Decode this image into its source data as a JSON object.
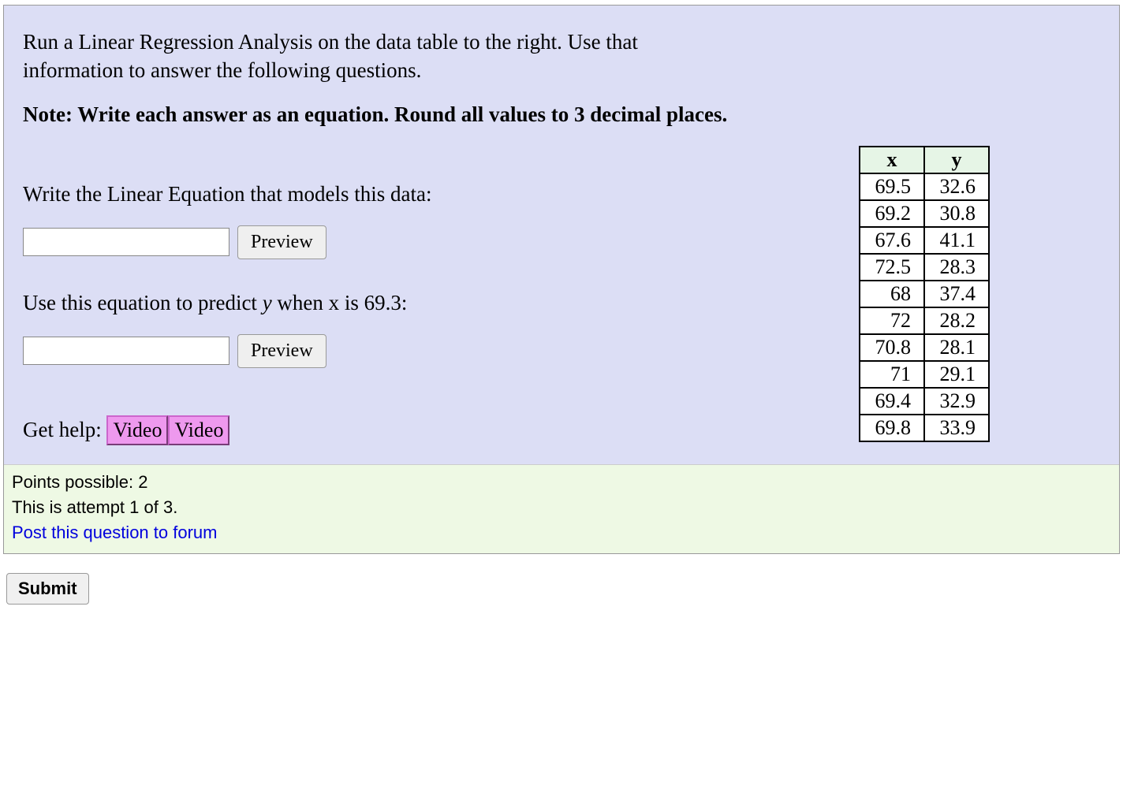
{
  "intro": "Run a Linear Regression Analysis on the data table to the right. Use that information to answer the following questions.",
  "note": "Note: Write each answer as an equation. Round all values to 3 decimal places.",
  "prompt1": "Write the Linear Equation that models this data:",
  "prompt2_prefix": "Use this equation to predict ",
  "prompt2_yvar": "y",
  "prompt2_suffix": " when x is 69.3:",
  "preview_label": "Preview",
  "table": {
    "headers": {
      "x": "x",
      "y": "y"
    },
    "rows": [
      {
        "x": "69.5",
        "y": "32.6"
      },
      {
        "x": "69.2",
        "y": "30.8"
      },
      {
        "x": "67.6",
        "y": "41.1"
      },
      {
        "x": "72.5",
        "y": "28.3"
      },
      {
        "x": "68",
        "y": "37.4"
      },
      {
        "x": "72",
        "y": "28.2"
      },
      {
        "x": "70.8",
        "y": "28.1"
      },
      {
        "x": "71",
        "y": "29.1"
      },
      {
        "x": "69.4",
        "y": "32.9"
      },
      {
        "x": "69.8",
        "y": "33.9"
      }
    ]
  },
  "help": {
    "label": "Get help:",
    "video1": "Video",
    "video2": "Video"
  },
  "footer": {
    "points": "Points possible: 2",
    "attempt": "This is attempt 1 of 3.",
    "forum": "Post this question to forum"
  },
  "submit": "Submit"
}
